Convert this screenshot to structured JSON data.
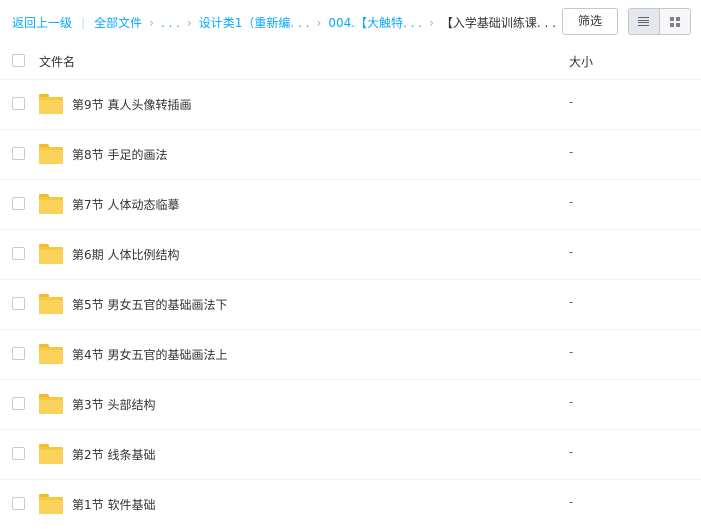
{
  "breadcrumb": {
    "back": "返回上一级",
    "all_files": "全部文件",
    "ellipsis": ". . .",
    "level1": "设计类1（重新编. . .",
    "level2": "004.【大触特. . .",
    "current": "【入学基础训练课. . ."
  },
  "toolbar": {
    "filter_label": "筛选",
    "view_list_icon": "list-view-icon",
    "view_grid_icon": "grid-view-icon",
    "active_view": "list"
  },
  "table": {
    "headers": {
      "name": "文件名",
      "size": "大小"
    },
    "rows": [
      {
        "name": "第9节  真人头像转插画",
        "size": "-"
      },
      {
        "name": "第8节  手足的画法",
        "size": "-"
      },
      {
        "name": "第7节  人体动态临摹",
        "size": "-"
      },
      {
        "name": "第6期  人体比例结构",
        "size": "-"
      },
      {
        "name": "第5节  男女五官的基础画法下",
        "size": "-"
      },
      {
        "name": "第4节  男女五官的基础画法上",
        "size": "-"
      },
      {
        "name": "第3节  头部结构",
        "size": "-"
      },
      {
        "name": "第2节  线条基础",
        "size": "-"
      },
      {
        "name": "第1节  软件基础",
        "size": "-"
      }
    ]
  },
  "colors": {
    "link": "#09aaff",
    "folder": "#f7c83f",
    "border": "#c3c7cc"
  }
}
